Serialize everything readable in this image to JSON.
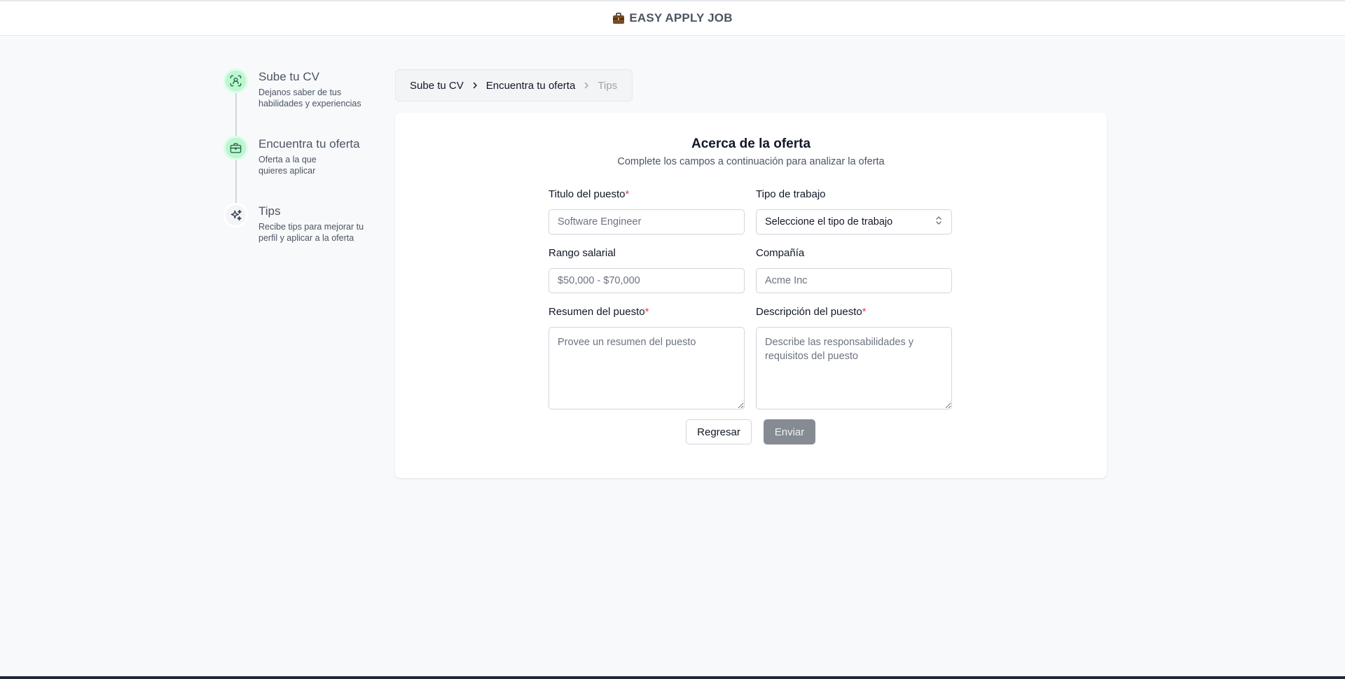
{
  "header": {
    "brand_icon": "briefcase-icon",
    "brand_name": "EASY APPLY JOB"
  },
  "steps": [
    {
      "title": "Sube tu CV",
      "desc_lines": [
        "Dejanos saber de tus",
        "habilidades y experiencias"
      ],
      "icon": "scan-user-icon",
      "status": "completed"
    },
    {
      "title": "Encuentra tu oferta",
      "desc_lines": [
        "Oferta a la que",
        "quieres aplicar"
      ],
      "icon": "briefcase-icon",
      "status": "completed"
    },
    {
      "title": "Tips",
      "desc_lines": [
        "Recibe tips para mejorar tu",
        "perfil y aplicar a la oferta"
      ],
      "icon": "sparkles-icon",
      "status": "pending"
    }
  ],
  "breadcrumb": [
    "Sube tu CV",
    "Encuentra tu oferta",
    "Tips"
  ],
  "form": {
    "title": "Acerca de la oferta",
    "subtitle": "Complete los campos a continuación para analizar la oferta",
    "job_title": {
      "label": "Titulo del puesto",
      "required": "*",
      "placeholder": "Software Engineer",
      "value": ""
    },
    "job_type": {
      "label": "Tipo de trabajo",
      "selected": "Seleccione el tipo de trabajo"
    },
    "salary": {
      "label": "Rango salarial",
      "placeholder": "$50,000 - $70,000",
      "value": ""
    },
    "company": {
      "label": "Compañía",
      "placeholder": "Acme Inc",
      "value": ""
    },
    "summary": {
      "label": "Resumen del puesto",
      "required": "*",
      "placeholder": "Provee un resumen del puesto"
    },
    "description": {
      "label": "Descripción del puesto",
      "required": "*",
      "placeholder": "Describe las responsabilidades y requisitos del puesto"
    },
    "back_label": "Regresar",
    "submit_label": "Enviar"
  },
  "colors": {
    "step_done": "#bbf7d0",
    "step_pending": "#f3f4f6",
    "required": "#ef4444",
    "submit_disabled": "#868b93",
    "page_bg": "#f8f9fb"
  }
}
